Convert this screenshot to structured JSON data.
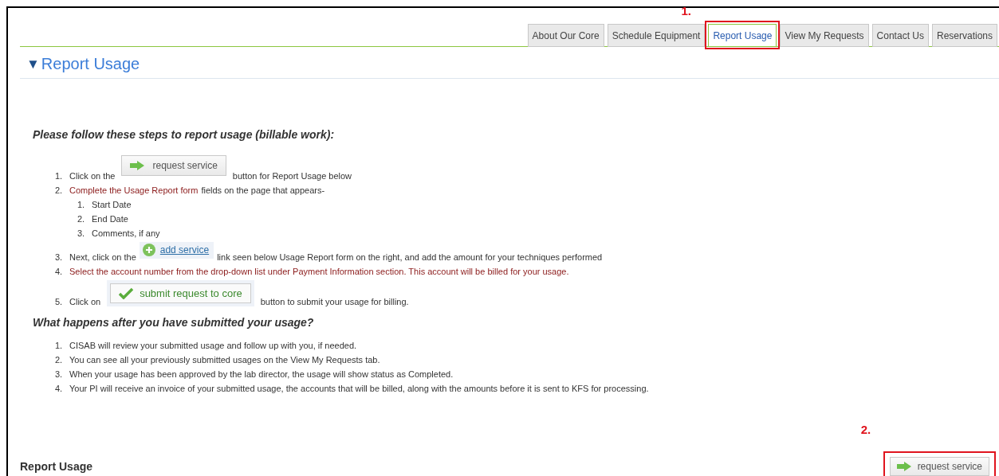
{
  "tabs": [
    {
      "label": "About Our Core",
      "selected": false
    },
    {
      "label": "Schedule Equipment",
      "selected": false
    },
    {
      "label": "Report Usage",
      "selected": true,
      "annotation": "1."
    },
    {
      "label": "View My Requests",
      "selected": false
    },
    {
      "label": "Contact Us",
      "selected": false
    },
    {
      "label": "Reservations",
      "selected": false
    }
  ],
  "section": {
    "toggle": "▼",
    "title": "Report Usage"
  },
  "instructions_heading": "Please follow these steps to report usage (billable work):",
  "steps": [
    {
      "number": "1.",
      "segments": [
        {
          "kind": "text",
          "text": "Click on the",
          "highlight": false
        },
        {
          "kind": "request",
          "label": "request service"
        },
        {
          "kind": "text",
          "text": "button for Report Usage below",
          "highlight": false
        }
      ]
    },
    {
      "number": "2.",
      "segments": [
        {
          "kind": "text",
          "text": "Complete the Usage Report form",
          "highlight": true
        },
        {
          "kind": "text",
          "text": "fields on the page that appears-",
          "highlight": false
        }
      ],
      "substeps": [
        {
          "number": "1.",
          "text": "Start Date"
        },
        {
          "number": "2.",
          "text": "End Date"
        },
        {
          "number": "3.",
          "text": "Comments, if any"
        }
      ]
    },
    {
      "number": "3.",
      "segments": [
        {
          "kind": "text",
          "text": "Next, click on the",
          "highlight": false
        },
        {
          "kind": "add",
          "label": "add service"
        },
        {
          "kind": "text",
          "text": "link seen below Usage Report form on the right, and add the amount for your techniques performed",
          "highlight": false
        }
      ]
    },
    {
      "number": "4.",
      "segments": [
        {
          "kind": "text",
          "text": "Select the account number from the drop-down list under Payment Information section. This account will be billed for your usage.",
          "highlight": true
        }
      ]
    },
    {
      "number": "5.",
      "segments": [
        {
          "kind": "text",
          "text": "Click on",
          "highlight": false
        },
        {
          "kind": "submit",
          "label": "submit request to core"
        },
        {
          "kind": "text",
          "text": "button to submit your usage for billing.",
          "highlight": false
        }
      ]
    }
  ],
  "after_heading": "What happens after you have submitted your usage?",
  "after_steps": [
    {
      "number": "1.",
      "text": "CISAB will review your submitted usage and follow up with you, if needed."
    },
    {
      "number": "2.",
      "text": "You can see all your previously submitted usages on the View My Requests tab."
    },
    {
      "number": "3.",
      "text": "When your usage has been approved by the lab director, the usage will show status as Completed."
    },
    {
      "number": "4.",
      "text": "Your PI will receive an invoice of your submitted usage, the accounts that will be billed, along with the amounts before it is sent to KFS for processing."
    }
  ],
  "footer": {
    "title": "Report Usage",
    "button": {
      "label": "request service",
      "annotation": "2."
    }
  }
}
